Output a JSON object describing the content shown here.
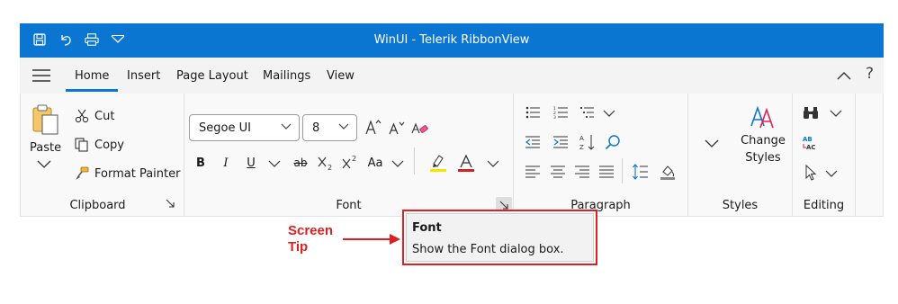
{
  "window": {
    "title": "WinUI - Telerik RibbonView"
  },
  "quick_access": [
    "save-icon",
    "undo-icon",
    "print-icon",
    "customize-icon"
  ],
  "tabs": [
    {
      "label": "Home",
      "active": true
    },
    {
      "label": "Insert"
    },
    {
      "label": "Page Layout"
    },
    {
      "label": "Mailings"
    },
    {
      "label": "View"
    }
  ],
  "help_label": "?",
  "clipboard": {
    "label": "Clipboard",
    "paste": "Paste",
    "cut": "Cut",
    "copy": "Copy",
    "format_painter": "Format Painter"
  },
  "font": {
    "label": "Font",
    "family": "Segoe UI",
    "size": "8",
    "bold": "B",
    "italic": "I",
    "underline": "U",
    "strike": "ab",
    "change_case": "Aa"
  },
  "paragraph": {
    "label": "Paragraph"
  },
  "styles": {
    "label": "Styles",
    "change_styles_line1": "Change",
    "change_styles_line2": "Styles"
  },
  "editing": {
    "label": "Editing"
  },
  "screentip": {
    "title": "Font",
    "description": "Show the Font dialog box."
  },
  "callout": {
    "line1": "Screen",
    "line2": "Tip"
  },
  "colors": {
    "accent": "#0a76d2",
    "callout": "#e02020"
  }
}
